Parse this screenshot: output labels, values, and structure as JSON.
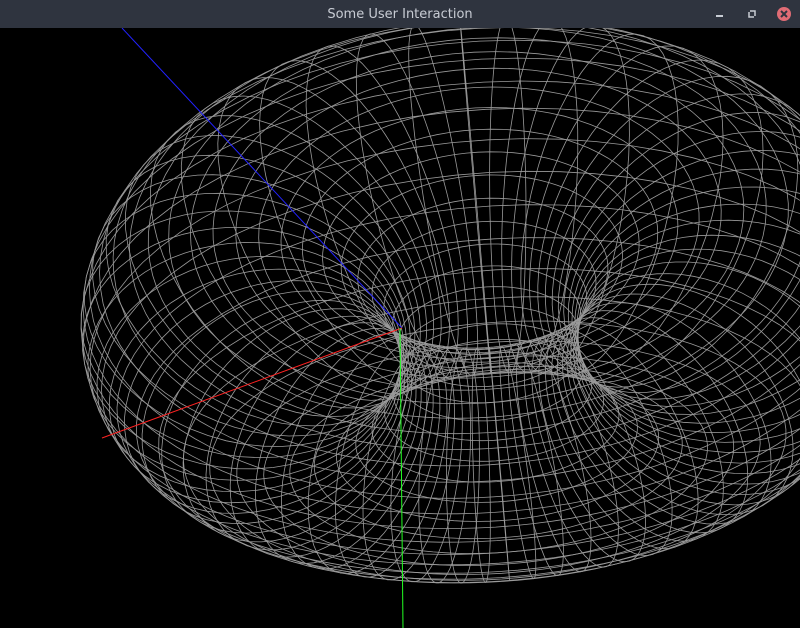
{
  "window": {
    "title": "Some User Interaction",
    "controls": [
      {
        "name": "minimize",
        "icon": "minimize-icon"
      },
      {
        "name": "maximize",
        "icon": "maximize-icon"
      },
      {
        "name": "close",
        "icon": "close-icon",
        "color": "#e06c75"
      }
    ]
  },
  "scene": {
    "background": "#000000",
    "mesh_color": "#9a9a9a",
    "axes": [
      {
        "name": "x-axis",
        "color": "#ff2020"
      },
      {
        "name": "y-axis",
        "color": "#20ff20"
      },
      {
        "name": "z-axis",
        "color": "#2020ff"
      }
    ]
  }
}
